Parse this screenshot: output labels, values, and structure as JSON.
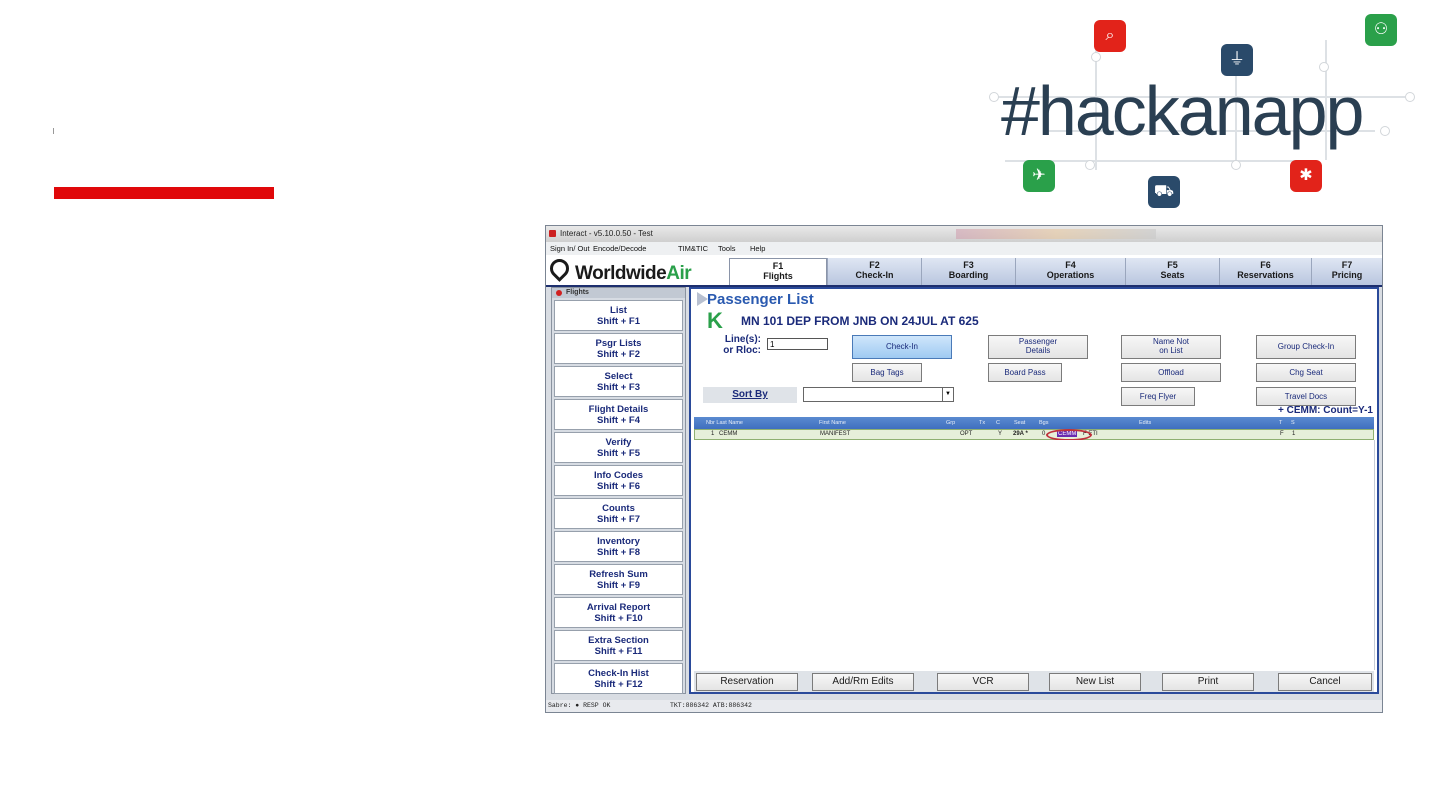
{
  "slide": {
    "hashtag": "#hackanapp",
    "colors": {
      "accent_red": "#e0080a",
      "hashtag_text": "#2a3f52"
    },
    "icons": [
      {
        "name": "search-icon",
        "glyph": "⌕",
        "color": "#e2231a"
      },
      {
        "name": "service-bell-icon",
        "glyph": "⏚",
        "color": "#2a4a6a"
      },
      {
        "name": "group-icon",
        "glyph": "⚇",
        "color": "#2aa04a"
      },
      {
        "name": "airplane-icon",
        "glyph": "✈",
        "color": "#2aa04a"
      },
      {
        "name": "luggage-cart-icon",
        "glyph": "⛟",
        "color": "#2a4a6a"
      },
      {
        "name": "network-icon",
        "glyph": "✱",
        "color": "#e2231a"
      }
    ]
  },
  "window": {
    "title": "Interact - v5.10.0.50 - Test",
    "menu": [
      "Sign In/ Out",
      "Encode/Decode",
      "TIM&TIC",
      "Tools",
      "Help"
    ]
  },
  "brand": {
    "name_main": "Worldwide",
    "name_accent": "Air",
    "colors": {
      "accent": "#2aa04a",
      "primary": "#1a2a7a"
    }
  },
  "function_tabs": [
    {
      "key": "F1",
      "label": "Flights",
      "active": true
    },
    {
      "key": "F2",
      "label": "Check-In",
      "active": false
    },
    {
      "key": "F3",
      "label": "Boarding",
      "active": false
    },
    {
      "key": "F4",
      "label": "Operations",
      "active": false
    },
    {
      "key": "F5",
      "label": "Seats",
      "active": false
    },
    {
      "key": "F6",
      "label": "Reservations",
      "active": false
    },
    {
      "key": "F7",
      "label": "Pricing",
      "active": false
    }
  ],
  "sidebar": {
    "header": "Flights",
    "items": [
      {
        "label": "List",
        "shortcut": "Shift + F1"
      },
      {
        "label": "Psgr Lists",
        "shortcut": "Shift + F2"
      },
      {
        "label": "Select",
        "shortcut": "Shift + F3"
      },
      {
        "label": "Flight Details",
        "shortcut": "Shift + F4"
      },
      {
        "label": "Verify",
        "shortcut": "Shift + F5"
      },
      {
        "label": "Info Codes",
        "shortcut": "Shift + F6"
      },
      {
        "label": "Counts",
        "shortcut": "Shift + F7"
      },
      {
        "label": "Inventory",
        "shortcut": "Shift + F8"
      },
      {
        "label": "Refresh Sum",
        "shortcut": "Shift + F9"
      },
      {
        "label": "Arrival Report",
        "shortcut": "Shift + F10"
      },
      {
        "label": "Extra Section",
        "shortcut": "Shift + F11"
      },
      {
        "label": "Check-In Hist",
        "shortcut": "Shift + F12"
      }
    ]
  },
  "passenger_list": {
    "title": "Passenger List",
    "airline_logo_letter": "K",
    "flight_line": "MN 101  DEP FROM JNB  ON 24JUL AT 625",
    "lines_label_1": "Line(s):",
    "lines_label_2": "or Rloc:",
    "lines_value": "1",
    "buttons": {
      "check_in": "Check-In",
      "passenger_details_1": "Passenger",
      "passenger_details_2": "Details",
      "name_not_on_list_1": "Name Not",
      "name_not_on_list_2": "on List",
      "group_check_in": "Group Check-In",
      "bag_tags": "Bag Tags",
      "board_pass": "Board Pass",
      "offload": "Offload",
      "chg_seat": "Chg Seat",
      "freq_flyer": "Freq Flyer",
      "travel_docs": "Travel Docs"
    },
    "sort_by_label": "Sort By",
    "sort_by_value": "",
    "count_line": "+ CEMM: Count=Y-1",
    "columns": [
      "Nbr Last Name",
      "First Name",
      "Grp",
      "Tx",
      "C",
      "Seat",
      "Bgs",
      "Edits",
      "T",
      "S"
    ],
    "rows": [
      {
        "nbr": "1",
        "last_name": "CEMM",
        "first_name": "MANIFEST",
        "tx": "OPT",
        "c": "Y",
        "seat": "29A *",
        "bgs": "0",
        "edit_code": "CEMM",
        "edit_extra": "F ETI",
        "t": "F",
        "s": "1"
      }
    ],
    "bottom_buttons": [
      "Reservation",
      "Add/Rm Edits",
      "VCR",
      "New List",
      "Print",
      "Cancel"
    ]
  },
  "status": {
    "left": "Sabre: ● RESP OK",
    "right": "TKT:886342 ATB:886342"
  }
}
